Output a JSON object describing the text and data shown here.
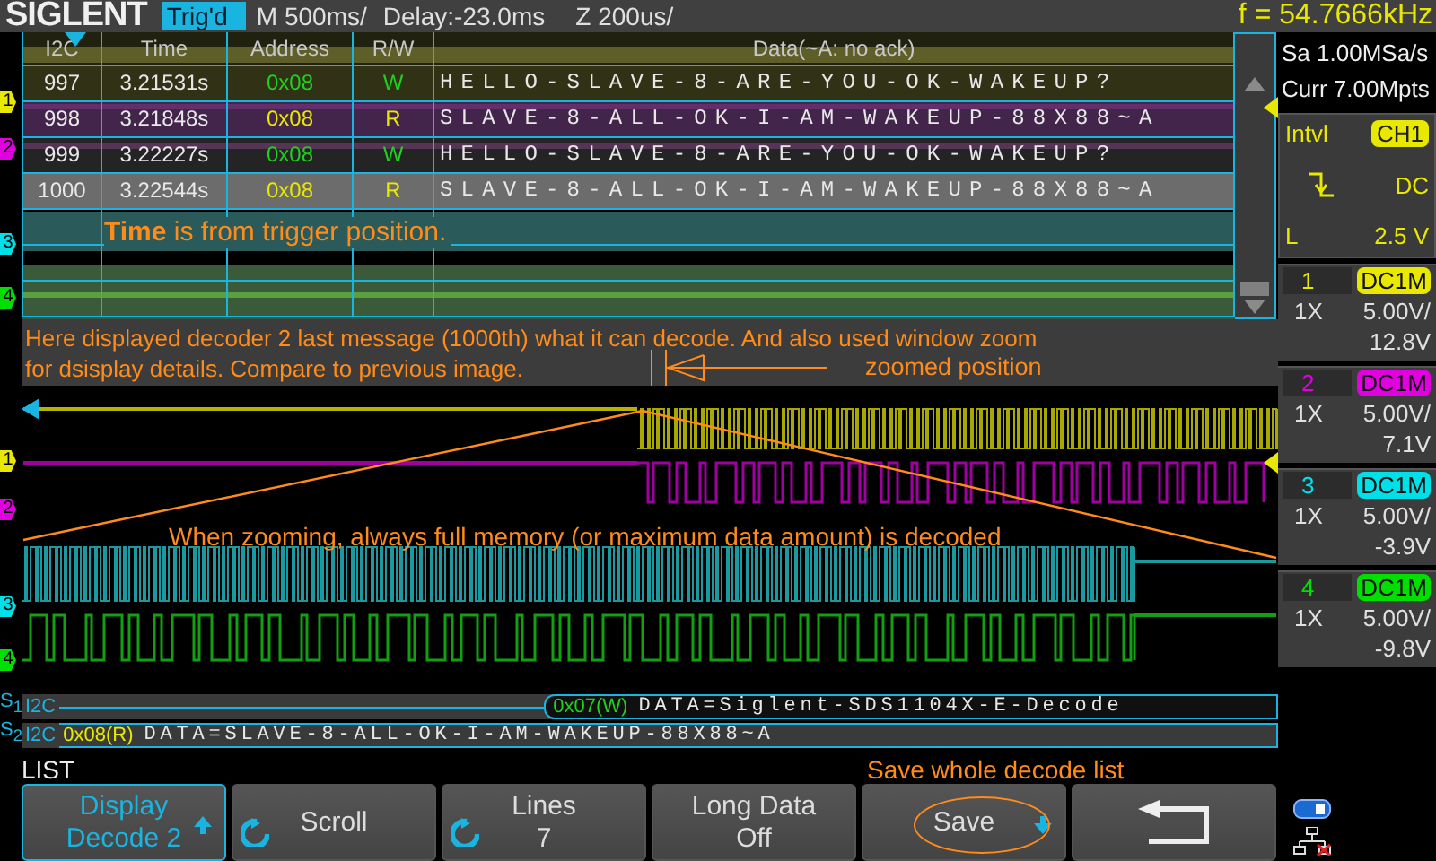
{
  "header": {
    "logo": "SIGLENT",
    "trigger_status": "Trig'd",
    "timebase": "M 500ms/",
    "delay": "Delay:-23.0ms",
    "zoom_timebase": "Z 200us/",
    "frequency": "f = 54.7666kHz"
  },
  "overview_markers": [
    {
      "label": "1",
      "color": "#e8e800"
    },
    {
      "label": "2",
      "color": "#e000e0"
    },
    {
      "label": "3",
      "color": "#00e0e8"
    },
    {
      "label": "4",
      "color": "#00e000"
    }
  ],
  "decode_list": {
    "columns": [
      "I2C",
      "Time",
      "Address",
      "R/W",
      "Data(~A: no ack)"
    ],
    "rows": [
      {
        "index": "997",
        "time": "3.21531s",
        "address": "0x08",
        "rw": "W",
        "kind": "write",
        "data": "HELLO-SLAVE-8-ARE-YOU-OK-WAKEUP?",
        "selected": false
      },
      {
        "index": "998",
        "time": "3.21848s",
        "address": "0x08",
        "rw": "R",
        "kind": "read",
        "data": "SLAVE-8-ALL-OK-I-AM-WAKEUP-88X88~A",
        "selected": false
      },
      {
        "index": "999",
        "time": "3.22227s",
        "address": "0x08",
        "rw": "W",
        "kind": "write",
        "data": "HELLO-SLAVE-8-ARE-YOU-OK-WAKEUP?",
        "selected": false
      },
      {
        "index": "1000",
        "time": "3.22544s",
        "address": "0x08",
        "rw": "R",
        "kind": "read",
        "data": "SLAVE-8-ALL-OK-I-AM-WAKEUP-88X88~A",
        "selected": true
      }
    ],
    "note": "**Time** is from trigger position."
  },
  "annotation": {
    "lines": [
      "Here displayed decoder 2 last message (1000th) what it can decode. And also used window zoom",
      "for dsisplay details. Compare to previous image."
    ],
    "pointer_label": "zoomed position"
  },
  "zoom_view": {
    "markers": [
      {
        "label": "1",
        "color": "#e8e800"
      },
      {
        "label": "2",
        "color": "#e000e0"
      },
      {
        "label": "3",
        "color": "#00e0e8"
      },
      {
        "label": "4",
        "color": "#00e000"
      }
    ],
    "note": "When zooming, always full memory (or maximum data amount)  is decoded"
  },
  "bus": [
    {
      "label": "S$_{1}$",
      "protocol": "I2C",
      "kind": "write",
      "address": "0x07(W)",
      "data": "DATA=Siglent-SDS1104X-E-Decode"
    },
    {
      "label": "S$_{2}$",
      "protocol": "I2C",
      "kind": "read",
      "address": "0x08(R)",
      "data": "DATA=SLAVE-8-ALL-OK-I-AM-WAKEUP-88X88~A"
    }
  ],
  "acquisition": {
    "sample_rate": "Sa 1.00MSa/s",
    "memory": "Curr 7.00Mpts"
  },
  "trigger": {
    "type": "Intvl",
    "source": "CH1",
    "coupling": "DC",
    "level_label": "L",
    "level_value": "2.5 V"
  },
  "channels": [
    {
      "number": "1",
      "coupling": "DC1M",
      "probe": "1X",
      "scale": "5.00V/",
      "offset": "12.8V",
      "color": "#e8e800"
    },
    {
      "number": "2",
      "coupling": "DC1M",
      "probe": "1X",
      "scale": "5.00V/",
      "offset": "7.1V",
      "color": "#e000e0"
    },
    {
      "number": "3",
      "coupling": "DC1M",
      "probe": "1X",
      "scale": "5.00V/",
      "offset": "-3.9V",
      "color": "#00e0e8"
    },
    {
      "number": "4",
      "coupling": "DC1M",
      "probe": "1X",
      "scale": "5.00V/",
      "offset": "-9.8V",
      "color": "#00e000"
    }
  ],
  "menu": {
    "title": "LIST",
    "hint": "Save whole decode list",
    "buttons": [
      {
        "kind": "up",
        "label": "Display",
        "value": "Decode 2",
        "selected": true
      },
      {
        "kind": "knob",
        "label": "Scroll",
        "selected": false
      },
      {
        "kind": "knob",
        "label": "Lines",
        "value": "7",
        "selected": false
      },
      {
        "kind": "plain",
        "label": "Long Data",
        "value": "Off",
        "selected": false
      },
      {
        "kind": "down",
        "label": "Save",
        "selected": false
      },
      {
        "kind": "back",
        "selected": false
      }
    ]
  }
}
